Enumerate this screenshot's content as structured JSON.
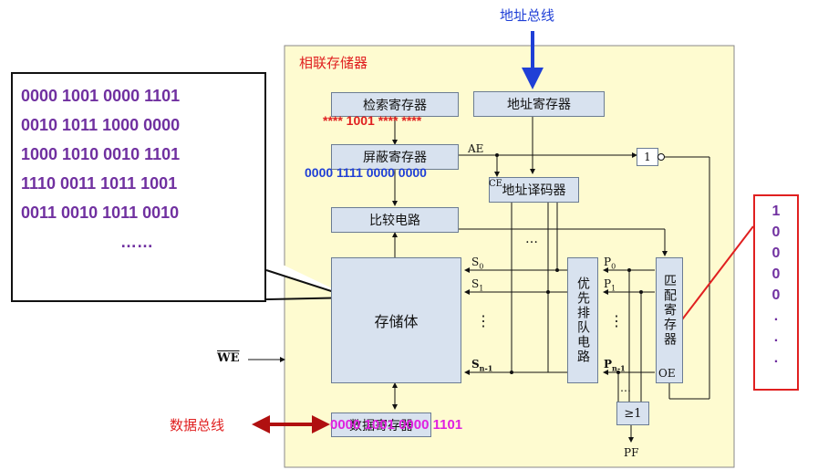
{
  "diagram": {
    "address_bus_label": "地址总线",
    "title": "相联存储器",
    "search_register": "检索寄存器",
    "address_register": "地址寄存器",
    "mask_register": "屏蔽寄存器",
    "address_decoder": "地址译码器",
    "compare_circuit": "比较电路",
    "storage": "存储体",
    "priority_circuit": "优先排队电路",
    "match_register": "匹配寄存器",
    "data_register": "数据寄存器",
    "not_gate": "1",
    "or_gate": "≥1",
    "signals": {
      "ae": "AE",
      "ce": "CE",
      "oe": "OE",
      "pf": "PF",
      "we": "WE",
      "s0": "S",
      "s0_sub": "0",
      "s1": "S",
      "s1_sub": "1",
      "sn": "S",
      "sn_sub": "n-1",
      "p0": "P",
      "p0_sub": "0",
      "p1": "P",
      "p1_sub": "1",
      "pn": "P",
      "pn_sub": "n-1",
      "dots_h": "…",
      "dots_v": "⋮"
    },
    "data_bus_label": "数据总线"
  },
  "overlays": {
    "search_value": "**** 1001 **** ****",
    "mask_value": "0000 1111 0000 0000",
    "data_value": "0000 1001 0000 1101"
  },
  "callout": {
    "lines": [
      "0000 1001 0000 1101",
      "0010 1011 1000 0000",
      "1000 1010 0010 1101",
      "1110 0011 1011 1001",
      "0011 0010 1011 0010",
      "……"
    ]
  },
  "match_bits": [
    "1",
    "0",
    "0",
    "0",
    "0",
    ".",
    ".",
    "."
  ],
  "colors": {
    "panel": "#fefbd0",
    "box": "#d8e2ef",
    "callout_text": "#7030a0",
    "red": "#e02020",
    "blue": "#1f3fd6",
    "magenta": "#e020e0",
    "dark_red": "#b01010"
  }
}
